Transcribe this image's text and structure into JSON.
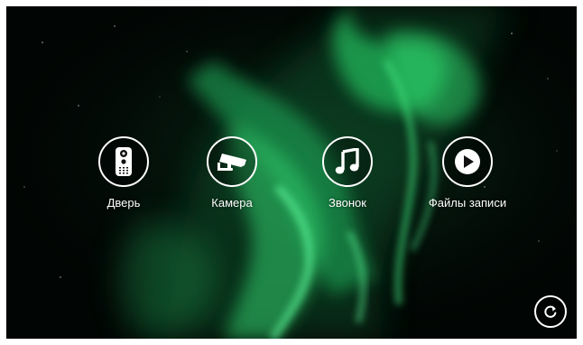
{
  "background": {
    "theme": "aurora-night",
    "colors": {
      "sky": "#010503",
      "aurora_bright": "#3fe07a",
      "aurora_mid": "#1a9c4f",
      "aurora_dark": "#0a4023"
    }
  },
  "menu": {
    "items": [
      {
        "id": "door",
        "label": "Дверь",
        "icon": "door-intercom-icon"
      },
      {
        "id": "camera",
        "label": "Камера",
        "icon": "security-camera-icon"
      },
      {
        "id": "ringtone",
        "label": "Звонок",
        "icon": "music-note-icon"
      },
      {
        "id": "records",
        "label": "Файлы записи",
        "icon": "play-icon"
      }
    ]
  },
  "refresh_button": {
    "icon": "refresh-icon"
  }
}
